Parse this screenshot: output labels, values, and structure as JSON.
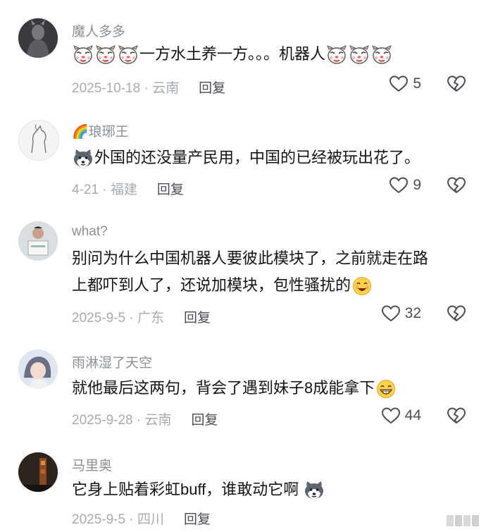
{
  "comments": [
    {
      "username": "魔人多多",
      "text_main": "一方水土养一方。。。机器人",
      "date_location": "2025-10-18 · 云南",
      "reply": "回复",
      "likes": "5",
      "avatar": "dark-figure-avatar"
    },
    {
      "username_emoji": "🌈",
      "username": "琅琊王",
      "text_main": "外国的还没量产民用，中国的已经被玩出花了。",
      "date_location": "4-21 · 福建",
      "reply": "回复",
      "likes": "9",
      "avatar": "horse-sketch-avatar"
    },
    {
      "username": "what?",
      "text_line1": "别问为什么中国机器人要彼此模块了，之前就走在路",
      "text_line2": "上都吓到人了，还说加模块，包性骚扰的",
      "date_location": "2025-9-5 · 广东",
      "reply": "回复",
      "likes": "32",
      "avatar": "person-holding-sign-avatar"
    },
    {
      "username": "雨淋湿了天空",
      "text_main": "就他最后这两句，背会了遇到妹子8成能拿下",
      "date_location": "2025-9-28 · 云南",
      "reply": "回复",
      "likes": "44",
      "avatar": "anime-character-avatar"
    },
    {
      "username": "马里奥",
      "text_main": "它身上贴着彩虹buff，谁敢动它啊",
      "date_location": "2025-9-5 · 四川",
      "reply": "回复",
      "likes": "",
      "avatar": "dark-street-avatar"
    }
  ],
  "icons": {
    "like": "heart-outline-icon",
    "dislike": "broken-heart-icon",
    "dog": "dog-face-emoji",
    "husky": "husky-face-emoji",
    "grin": "grinning-emoji",
    "smile": "smiling-emoji"
  },
  "colors": {
    "username": "#8a8f96",
    "text": "#141414",
    "meta": "#a6abb2"
  }
}
